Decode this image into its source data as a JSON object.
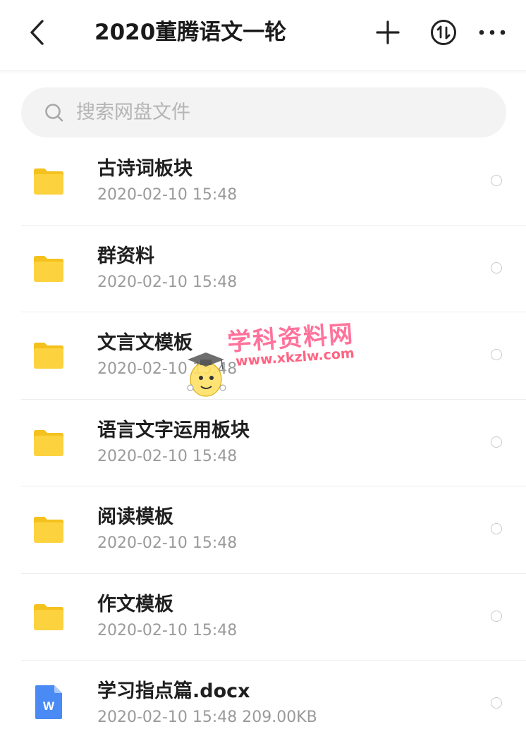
{
  "header": {
    "title": "2020董腾语文一轮",
    "back_icon": "chevron-left-icon",
    "add_icon": "plus-icon",
    "sort_icon": "sort-arrows-circle-icon",
    "more_icon": "more-horizontal-icon"
  },
  "search": {
    "placeholder": "搜索网盘文件",
    "value": "",
    "icon": "search-icon"
  },
  "files": [
    {
      "name": "古诗词板块",
      "meta": "2020-02-10  15:48",
      "type": "folder"
    },
    {
      "name": "群资料",
      "meta": "2020-02-10  15:48",
      "type": "folder"
    },
    {
      "name": "文言文模板",
      "meta": "2020-02-10  15:48",
      "type": "folder"
    },
    {
      "name": "语言文字运用板块",
      "meta": "2020-02-10  15:48",
      "type": "folder"
    },
    {
      "name": "阅读模板",
      "meta": "2020-02-10  15:48",
      "type": "folder"
    },
    {
      "name": "作文模板",
      "meta": "2020-02-10  15:48",
      "type": "folder"
    },
    {
      "name": "学习指点篇.docx",
      "meta": "2020-02-10  15:48  209.00KB",
      "type": "docx",
      "badge": "W"
    }
  ],
  "watermark": {
    "title": "学科资料网",
    "url": "www.xkzlw.com"
  },
  "colors": {
    "folder": "#fcd33f",
    "folder_tab": "#f5c11e",
    "docx": "#4a8af4",
    "watermark": "#ff5a8a"
  }
}
